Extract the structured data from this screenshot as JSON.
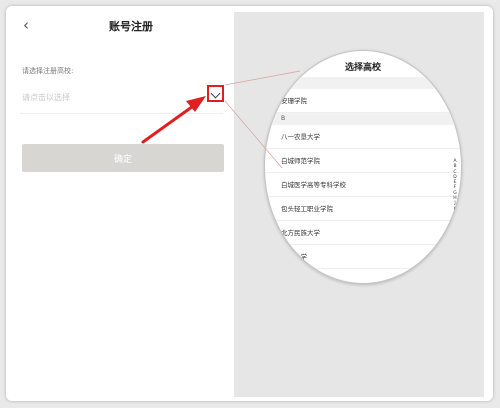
{
  "header": {
    "back_icon": "chevron-left-icon",
    "title": "账号注册"
  },
  "form": {
    "label": "请选择注册高校:",
    "placeholder": "请点击以选择",
    "dropdown_icon": "chevron-down-icon",
    "confirm_label": "确定"
  },
  "magnifier": {
    "title": "选择高校",
    "sections": [
      {
        "letter": "",
        "items": [
          "安珊学院"
        ]
      },
      {
        "letter": "B",
        "items": [
          "八一农垦大学",
          "白城师范学院",
          "白城医学高等专科学校",
          "包头轻工职业学院",
          "北方民族大学",
          "北华大学"
        ]
      }
    ],
    "index": [
      "A",
      "B",
      "C",
      "D",
      "E",
      "F",
      "G",
      "H",
      "J",
      "K",
      "L",
      "M",
      "N",
      "P"
    ]
  },
  "colors": {
    "highlight": "#e02020",
    "confirm_bg": "#d8d6d2",
    "right_bg": "#e7e6e6"
  }
}
